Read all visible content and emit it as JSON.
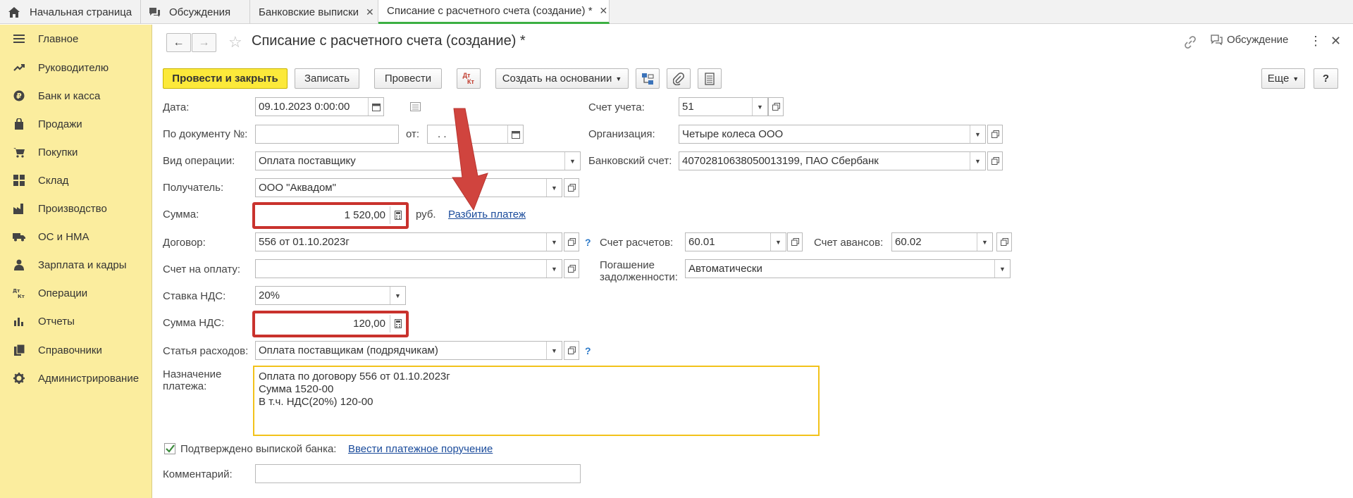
{
  "tabs": [
    {
      "label": "Начальная страница"
    },
    {
      "label": "Обсуждения"
    },
    {
      "label": "Банковские выписки"
    },
    {
      "label": "Списание с расчетного счета (создание) *"
    }
  ],
  "sidebar": {
    "items": [
      {
        "label": "Главное",
        "icon": "menu-icon"
      },
      {
        "label": "Руководителю",
        "icon": "trend-icon"
      },
      {
        "label": "Банк и касса",
        "icon": "ruble-icon"
      },
      {
        "label": "Продажи",
        "icon": "bag-icon"
      },
      {
        "label": "Покупки",
        "icon": "cart-icon"
      },
      {
        "label": "Склад",
        "icon": "warehouse-icon"
      },
      {
        "label": "Производство",
        "icon": "factory-icon"
      },
      {
        "label": "ОС и НМА",
        "icon": "truck-icon"
      },
      {
        "label": "Зарплата и кадры",
        "icon": "person-icon"
      },
      {
        "label": "Операции",
        "icon": "dt-kt-icon"
      },
      {
        "label": "Отчеты",
        "icon": "bar-chart-icon"
      },
      {
        "label": "Справочники",
        "icon": "books-icon"
      },
      {
        "label": "Администрирование",
        "icon": "gear-icon"
      }
    ]
  },
  "header": {
    "title": "Списание с расчетного счета (создание) *",
    "discussion": "Обсуждение"
  },
  "toolbar": {
    "post_close": "Провести и закрыть",
    "save": "Записать",
    "post": "Провести",
    "dtkt_top": "Дт",
    "dtkt_bottom": "Кт",
    "create_basis": "Создать на основании",
    "more": "Еще",
    "help": "?"
  },
  "form": {
    "date_label": "Дата:",
    "date_value": "09.10.2023  0:00:00",
    "docnum_label": "По документу №:",
    "docnum_value": "",
    "from_label": "от:",
    "from_value": " .  .",
    "optype_label": "Вид операции:",
    "optype_value": "Оплата поставщику",
    "recipient_label": "Получатель:",
    "recipient_value": "ООО \"Аквадом\"",
    "sum_label": "Сумма:",
    "sum_value": "1 520,00",
    "currency": "руб.",
    "split_link": "Разбить платеж",
    "contract_label": "Договор:",
    "contract_value": "556 от 01.10.2023г",
    "invoice_label": "Счет на оплату:",
    "invoice_value": "",
    "vat_rate_label": "Ставка НДС:",
    "vat_rate_value": "20%",
    "vat_sum_label": "Сумма НДС:",
    "vat_sum_value": "120,00",
    "expense_label": "Статья расходов:",
    "expense_value": "Оплата поставщикам (подрядчикам)",
    "purpose_label_1": "Назначение",
    "purpose_label_2": "платежа:",
    "purpose_line1": "Оплата по договору 556 от 01.10.2023г",
    "purpose_line2": "Сумма 1520-00",
    "purpose_line3": "В т.ч. НДС(20%) 120-00",
    "confirmed_label": "Подтверждено выпиской банка:",
    "confirmed_checked": true,
    "enter_order_link": "Ввести платежное поручение",
    "comment_label": "Комментарий:",
    "comment_value": "",
    "account_label": "Счет учета:",
    "account_value": "51",
    "org_label": "Организация:",
    "org_value": "Четыре колеса ООО",
    "bank_account_label": "Банковский счет:",
    "bank_account_value": "40702810638050013199, ПАО Сбербанк",
    "settle_account_label": "Счет расчетов:",
    "settle_account_value": "60.01",
    "advance_account_label": "Счет авансов:",
    "advance_account_value": "60.02",
    "repay_label_1": "Погашение",
    "repay_label_2": "задолженности:",
    "repay_value": "Автоматически"
  },
  "colors": {
    "sidebar_bg": "#fbed9e",
    "primary_button": "#fce93a",
    "highlight_red": "#c9322d",
    "active_tab_underline": "#3cb043",
    "link": "#1a4b9b"
  }
}
